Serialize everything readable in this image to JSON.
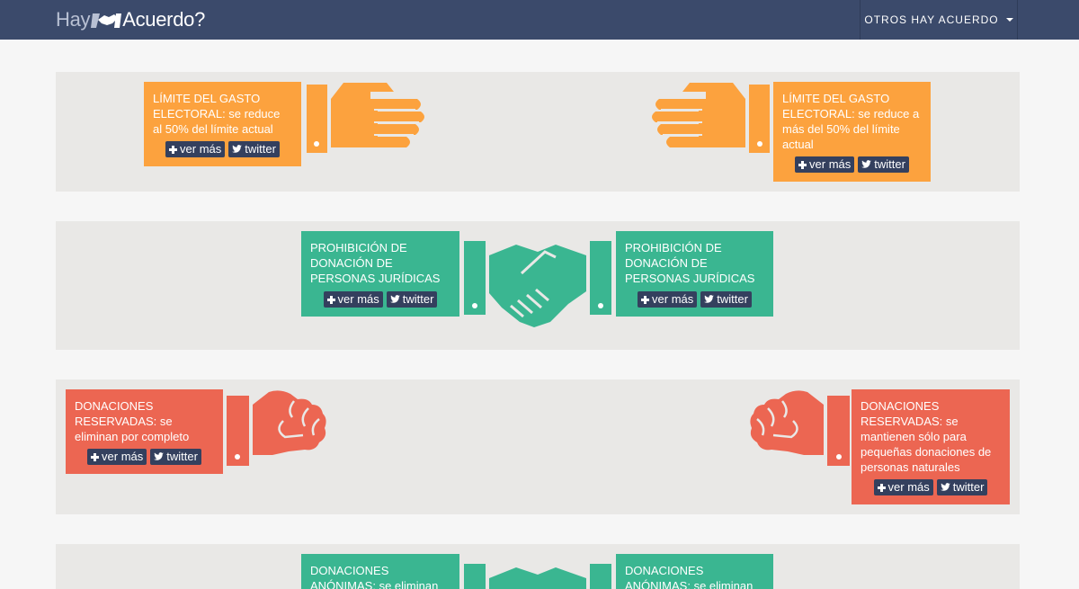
{
  "brand": {
    "left": "Hay",
    "right": "Acuerdo?"
  },
  "nav": {
    "menu_label": "OTROS HAY ACUERDO"
  },
  "buttons": {
    "more": "ver más",
    "twitter": "twitter"
  },
  "colors": {
    "navbar": "#3b4a6b",
    "orange": "#fca23e",
    "green": "#3ab691",
    "red": "#ec6652",
    "button": "#34405e",
    "band": "#e9e8e6"
  },
  "rows": [
    {
      "left": {
        "title": "LÍMITE DEL GASTO ELECTORAL",
        "body": ": se reduce al 50% del límite actual"
      },
      "right": {
        "title": "LÍMITE DEL GASTO ELECTORAL",
        "body": ": se reduce a más del 50% del límite actual"
      }
    },
    {
      "left": {
        "title": "PROHIBICIÓN DE DONACIÓN DE PERSONAS JURÍDICAS"
      },
      "right": {
        "title": "PROHIBICIÓN DE DONACIÓN DE PERSONAS JURÍDICAS"
      }
    },
    {
      "left": {
        "title": "DONACIONES RESERVADAS",
        "body": ": se eliminan por completo"
      },
      "right": {
        "title": "DONACIONES RESERVADAS",
        "body": ": se mantienen sólo para pequeñas donaciones de personas naturales"
      }
    },
    {
      "left": {
        "title": "DONACIONES ANÓNIMAS",
        "body": ": se eliminan por completo"
      },
      "right": {
        "title": "DONACIONES ANÓNIMAS",
        "body": ": se eliminan por completo"
      }
    }
  ]
}
